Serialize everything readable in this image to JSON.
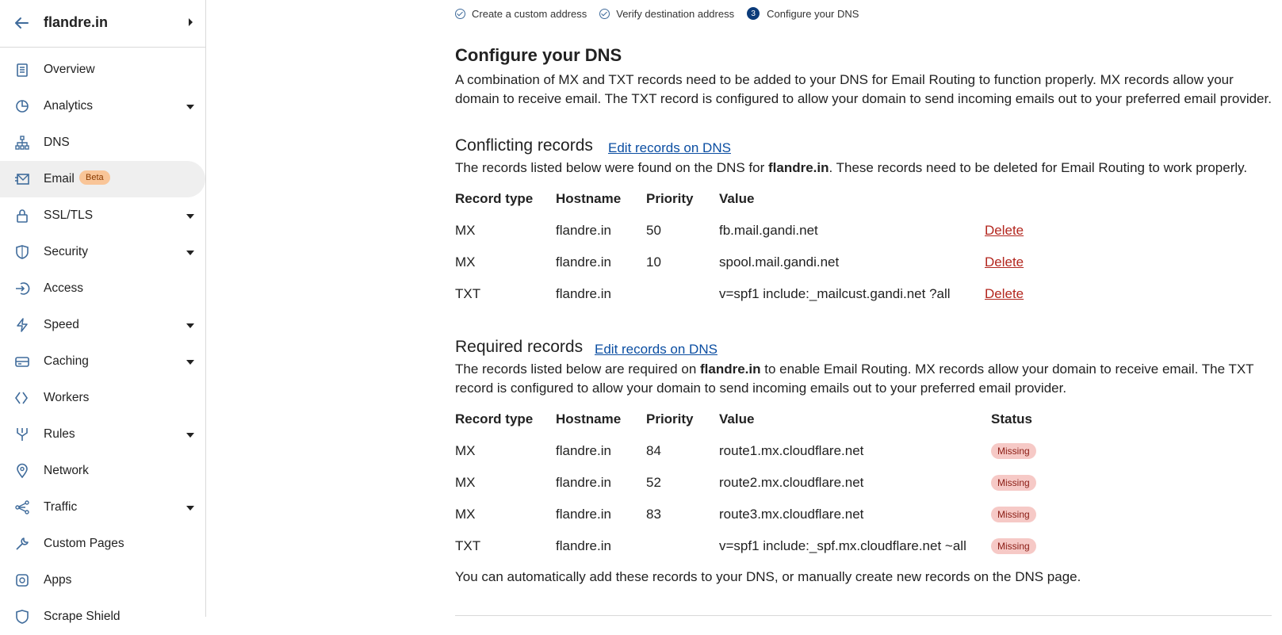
{
  "sidebar": {
    "domain": "flandre.in",
    "items": [
      {
        "label": "Overview",
        "icon": "clipboard-icon",
        "caret": false
      },
      {
        "label": "Analytics",
        "icon": "pie-chart-icon",
        "caret": true
      },
      {
        "label": "DNS",
        "icon": "sitemap-icon",
        "caret": false
      },
      {
        "label": "Email",
        "icon": "email-icon",
        "caret": false,
        "badge": "Beta",
        "active": true
      },
      {
        "label": "SSL/TLS",
        "icon": "lock-icon",
        "caret": true
      },
      {
        "label": "Security",
        "icon": "shield-icon",
        "caret": true
      },
      {
        "label": "Access",
        "icon": "access-icon",
        "caret": false
      },
      {
        "label": "Speed",
        "icon": "bolt-icon",
        "caret": true
      },
      {
        "label": "Caching",
        "icon": "cache-icon",
        "caret": true
      },
      {
        "label": "Workers",
        "icon": "workers-icon",
        "caret": false
      },
      {
        "label": "Rules",
        "icon": "rules-icon",
        "caret": true
      },
      {
        "label": "Network",
        "icon": "location-pin-icon",
        "caret": false
      },
      {
        "label": "Traffic",
        "icon": "traffic-icon",
        "caret": true
      },
      {
        "label": "Custom Pages",
        "icon": "wrench-icon",
        "caret": false
      },
      {
        "label": "Apps",
        "icon": "apps-icon",
        "caret": false
      },
      {
        "label": "Scrape Shield",
        "icon": "shield-icon",
        "caret": false
      }
    ]
  },
  "steps": [
    {
      "label": "Create a custom address",
      "state": "done"
    },
    {
      "label": "Verify destination address",
      "state": "done"
    },
    {
      "label": "Configure your DNS",
      "state": "current",
      "num": "3"
    }
  ],
  "main": {
    "title": "Configure your DNS",
    "intro": "A combination of MX and TXT records need to be added to your DNS for Email Routing to function properly. MX records allow your domain to receive email. The TXT record is configured to allow your domain to send incoming emails out to your preferred email provider.",
    "conflicting": {
      "title": "Conflicting records",
      "link": "Edit records on DNS",
      "desc_pre": "The records listed below were found on the DNS for ",
      "desc_domain": "flandre.in",
      "desc_post": ". These records need to be deleted for Email Routing to work properly.",
      "headers": [
        "Record type",
        "Hostname",
        "Priority",
        "Value"
      ],
      "rows": [
        {
          "type": "MX",
          "host": "flandre.in",
          "priority": "50",
          "value": "fb.mail.gandi.net",
          "action": "Delete"
        },
        {
          "type": "MX",
          "host": "flandre.in",
          "priority": "10",
          "value": "spool.mail.gandi.net",
          "action": "Delete"
        },
        {
          "type": "TXT",
          "host": "flandre.in",
          "priority": "",
          "value": "v=spf1 include:_mailcust.gandi.net ?all",
          "action": "Delete"
        }
      ]
    },
    "required": {
      "title": "Required records",
      "link": "Edit records on DNS",
      "desc_pre": "The records listed below are required on ",
      "desc_domain": "flandre.in",
      "desc_post": " to enable Email Routing. MX records allow your domain to receive email. The TXT record is configured to allow your domain to send incoming emails out to your preferred email provider.",
      "headers": [
        "Record type",
        "Hostname",
        "Priority",
        "Value",
        "Status"
      ],
      "rows": [
        {
          "type": "MX",
          "host": "flandre.in",
          "priority": "84",
          "value": "route1.mx.cloudflare.net",
          "status": "Missing"
        },
        {
          "type": "MX",
          "host": "flandre.in",
          "priority": "52",
          "value": "route2.mx.cloudflare.net",
          "status": "Missing"
        },
        {
          "type": "MX",
          "host": "flandre.in",
          "priority": "83",
          "value": "route3.mx.cloudflare.net",
          "status": "Missing"
        },
        {
          "type": "TXT",
          "host": "flandre.in",
          "priority": "",
          "value": "v=spf1 include:_spf.mx.cloudflare.net ~all",
          "status": "Missing"
        }
      ]
    },
    "footer": "You can automatically add these records to your DNS, or manually create new records on the DNS page."
  },
  "colors": {
    "link": "#0b4ea2",
    "delete": "#b3261e",
    "missing_bg": "#f6c9c6",
    "beta_bg": "#f9c598"
  }
}
